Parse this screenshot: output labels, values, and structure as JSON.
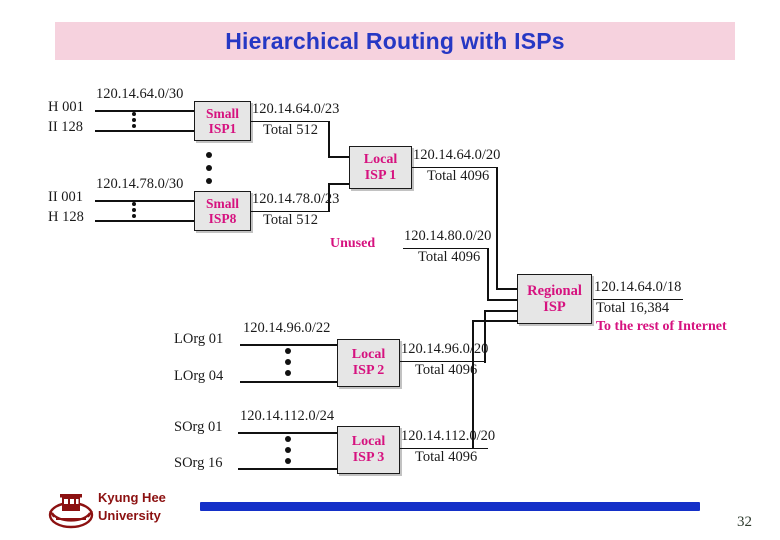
{
  "slide": {
    "title": "Hierarchical Routing with ISPs",
    "page_number": "32",
    "colors": {
      "title_banner_bg": "#f6d2de",
      "title_text": "#2638c4",
      "box_fill": "#e6e6e6",
      "box_text": "#d6127f",
      "line": "#111111",
      "footer_bar": "#1430c8",
      "footer_text": "#8c1111"
    }
  },
  "footer": {
    "university_line1": "Kyung Hee",
    "university_line2": "University"
  },
  "diagram": {
    "small_isp_groups": [
      {
        "host_top": "H 001",
        "host_bottom": "II 128",
        "link_prefix": "120.14.64.0/30",
        "box_line1": "Small",
        "box_line2": "ISP1",
        "out_prefix": "120.14.64.0/23",
        "out_total": "Total 512"
      },
      {
        "host_top": "II 001",
        "host_bottom": "H 128",
        "link_prefix": "120.14.78.0/30",
        "box_line1": "Small",
        "box_line2": "ISP8",
        "out_prefix": "120.14.78.0/23",
        "out_total": "Total 512"
      }
    ],
    "local_isp_1": {
      "box_line1": "Local",
      "box_line2": "ISP 1",
      "out_prefix": "120.14.64.0/20",
      "out_total": "Total 4096"
    },
    "unused": {
      "label": "Unused",
      "prefix": "120.14.80.0/20",
      "total": "Total 4096"
    },
    "local_isp_2": {
      "org_top": "LOrg 01",
      "org_bottom": "LOrg 04",
      "link_prefix": "120.14.96.0/22",
      "box_line1": "Local",
      "box_line2": "ISP 2",
      "out_prefix": "120.14.96.0/20",
      "out_total": "Total 4096"
    },
    "local_isp_3": {
      "org_top": "SOrg 01",
      "org_bottom": "SOrg 16",
      "link_prefix": "120.14.112.0/24",
      "box_line1": "Local",
      "box_line2": "ISP 3",
      "out_prefix": "120.14.112.0/20",
      "out_total": "Total 4096"
    },
    "regional_isp": {
      "box_line1": "Regional",
      "box_line2": "ISP",
      "out_prefix": "120.14.64.0/18",
      "out_total": "Total 16,384",
      "internet_note": "To the rest of Internet"
    }
  }
}
